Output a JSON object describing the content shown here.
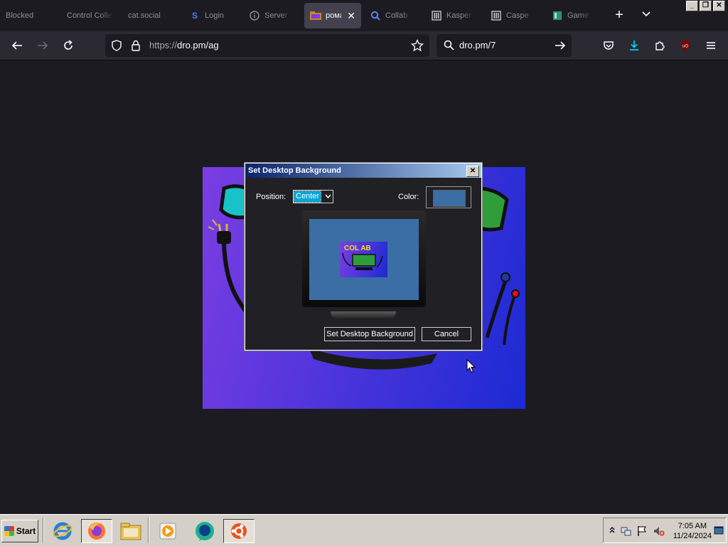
{
  "browser": {
    "tabs": [
      {
        "label": "Blocked",
        "icon": "none"
      },
      {
        "label": "Control Colle",
        "icon": "none"
      },
      {
        "label": "cat.social",
        "icon": "none"
      },
      {
        "label": "Login",
        "icon": "s-logo-icon"
      },
      {
        "label": "Server",
        "icon": "info-icon"
      },
      {
        "label": "рома",
        "icon": "folder-image-icon",
        "active": true
      },
      {
        "label": "Collab",
        "icon": "search-icon"
      },
      {
        "label": "Kasper",
        "icon": "building-icon"
      },
      {
        "label": "Caspe",
        "icon": "building-icon"
      },
      {
        "label": "Game",
        "icon": "window-icon"
      }
    ],
    "url": {
      "scheme": "https://",
      "host_path": "dro.pm/ag"
    },
    "search_text": "dro.pm/7"
  },
  "dialog": {
    "title": "Set Desktop Background",
    "position_label": "Position:",
    "position_value": "Center",
    "color_label": "Color:",
    "color_value": "#3a6ea5",
    "set_button": "Set Desktop Background",
    "cancel_button": "Cancel",
    "close_glyph": "✕"
  },
  "taskbar": {
    "start_label": "Start",
    "quick_launch": [
      "ie-icon",
      "firefox-icon",
      "folder-icon",
      "media-player-icon",
      "messenger-icon",
      "ubuntu-icon"
    ],
    "clock_time": "7:05 AM",
    "clock_date": "11/24/2024"
  },
  "colors": {
    "wallpaper_start": "#7a3ee2",
    "wallpaper_end": "#1c2ad3",
    "desktop_bg": "#3a6ea5",
    "title_gradient_start": "#0a246a",
    "title_gradient_end": "#a6caf0"
  }
}
